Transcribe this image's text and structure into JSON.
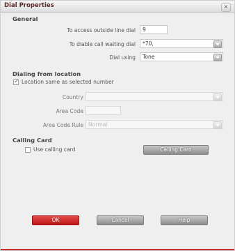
{
  "dialog": {
    "title": "Dial Properties",
    "close_symbol": "×"
  },
  "general": {
    "heading": "General",
    "outside_line_label": "To access outside line dial",
    "outside_line_value": "9",
    "call_waiting_label": "To diable call waiting dial",
    "call_waiting_value": "*70,",
    "dial_using_label": "Dial using",
    "dial_using_value": "Tone"
  },
  "location": {
    "heading": "Dialing from location",
    "same_as_selected_label": "Location same as selected number",
    "same_as_selected_checked": true,
    "country_label": "Country",
    "country_value": "",
    "area_code_label": "Area Code",
    "area_code_value": "",
    "area_code_rule_label": "Area Code Rule",
    "area_code_rule_value": "Normal"
  },
  "calling_card": {
    "heading": "Calling Card",
    "use_label": "Use calling card",
    "use_checked": false,
    "button_label": "Calling Card"
  },
  "footer": {
    "ok_label": "OK",
    "cancel_label": "Cancel",
    "help_label": "Help"
  },
  "colors": {
    "ok_button": "#d42a2a",
    "accent_line": "#c93030",
    "title_text": "#5a2a2a"
  }
}
